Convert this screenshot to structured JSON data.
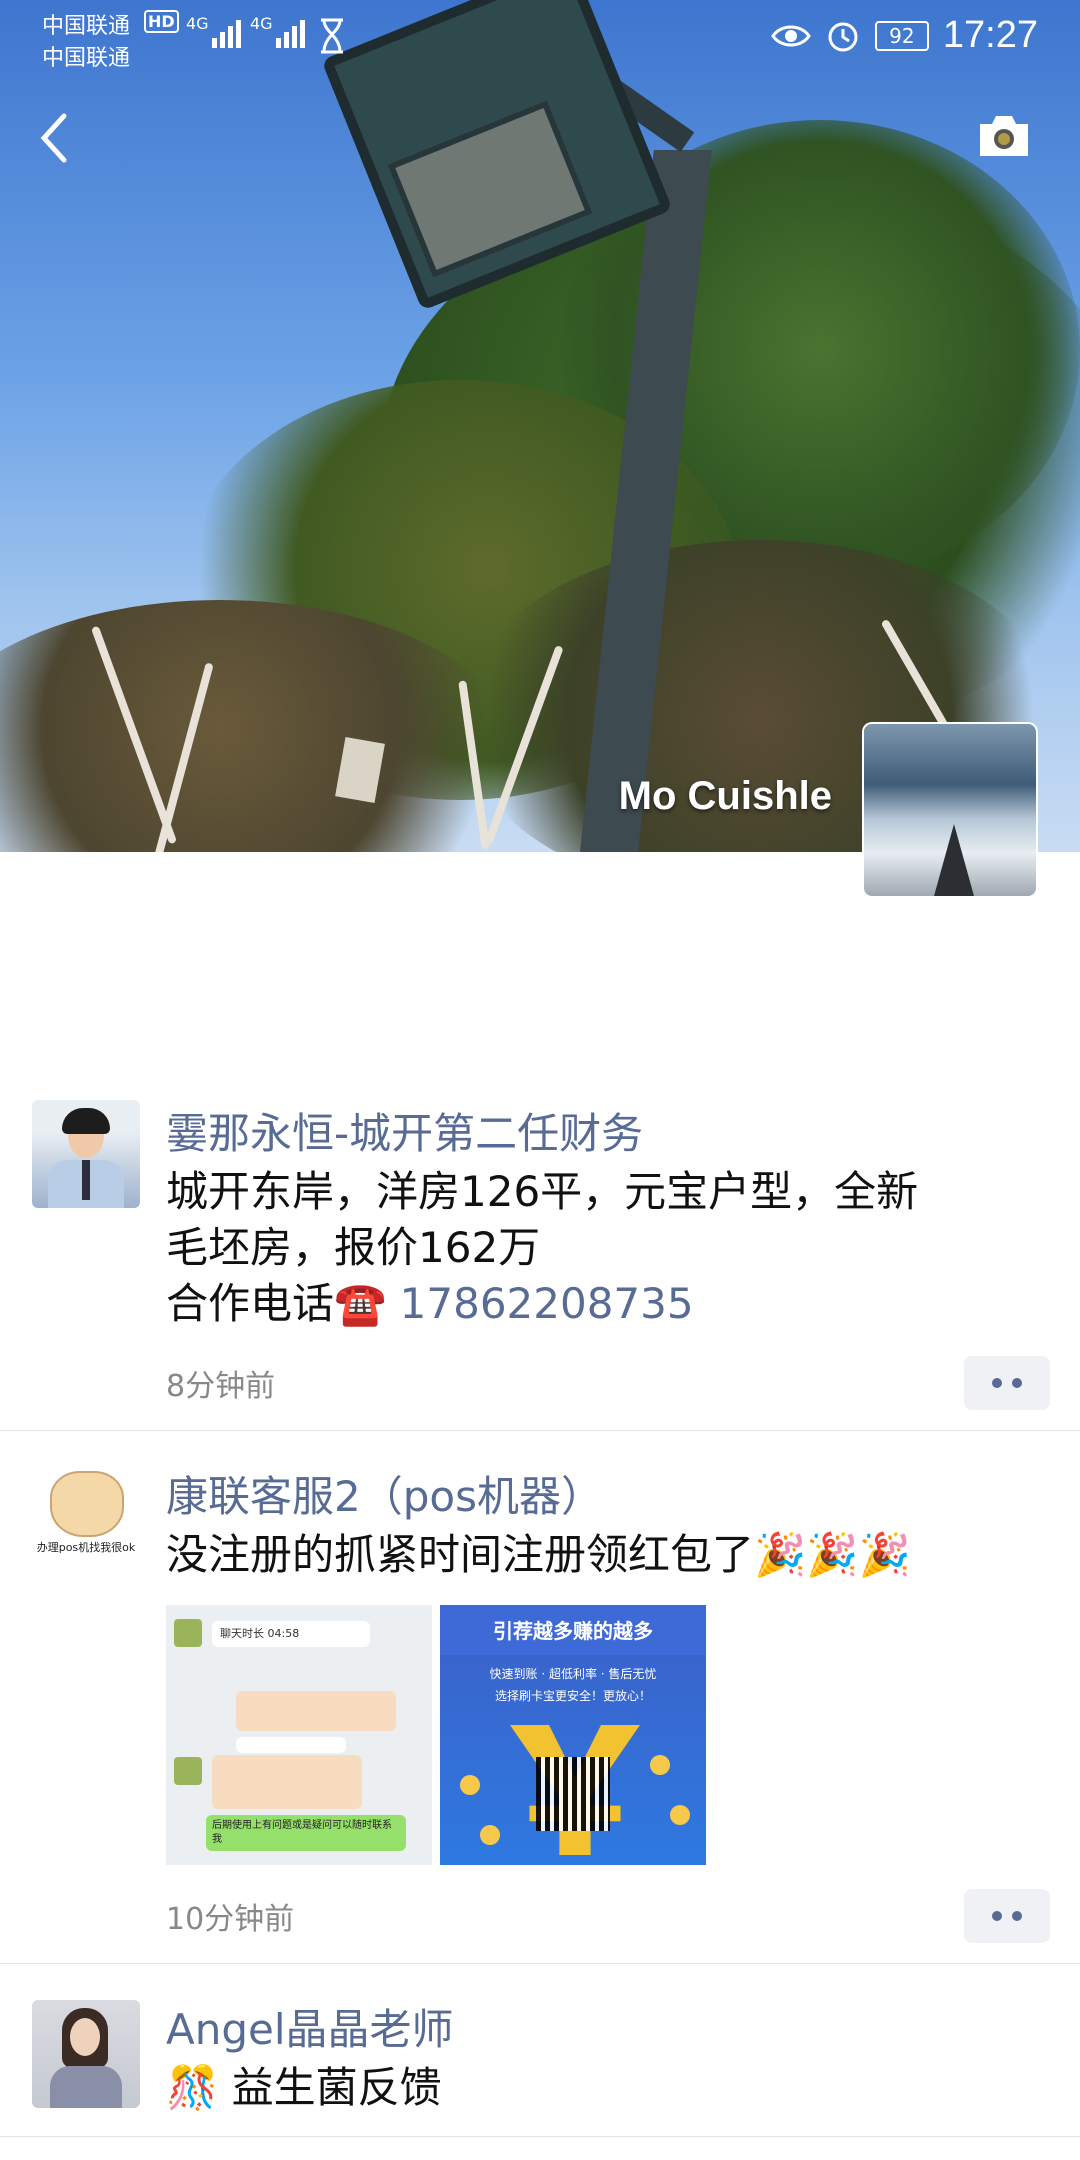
{
  "status_bar": {
    "carrier_1": "中国联通",
    "carrier_2": "中国联通",
    "hd_badge": "HD",
    "network_1": "4G",
    "network_2": "4G",
    "battery": "92",
    "time": "17:27"
  },
  "cover": {
    "profile_name": "Mo Cuishle"
  },
  "posts": [
    {
      "author": "霎那永恒-城开第二任财务",
      "text_line1": "城开东岸，洋房126平，元宝户型，全新",
      "text_line2": "毛坯房，报价162万",
      "text_line3_prefix": "合作电话☎️ ",
      "phone": "17862208735",
      "time_ago": "8分钟前"
    },
    {
      "author": "康联客服2（pos机器）",
      "text": "没注册的抓紧时间注册领红包了🎉🎉🎉",
      "avatar_caption": "办理pos机找我很ok",
      "image1": {
        "chat_duration": "聊天时长 04:58",
        "bottom_text": "后期使用上有问题或是疑问可以随时联系我"
      },
      "image2": {
        "title": "引荐越多赚的越多",
        "line1": "快速到账 · 超低利率 · 售后无忧",
        "line2": "选择刷卡宝更安全！更放心！"
      },
      "time_ago": "10分钟前"
    },
    {
      "author": "Angel晶晶老师",
      "text": "🎊 益生菌反馈"
    }
  ],
  "colors": {
    "link": "#576b95",
    "divider": "#e3e3e3"
  }
}
